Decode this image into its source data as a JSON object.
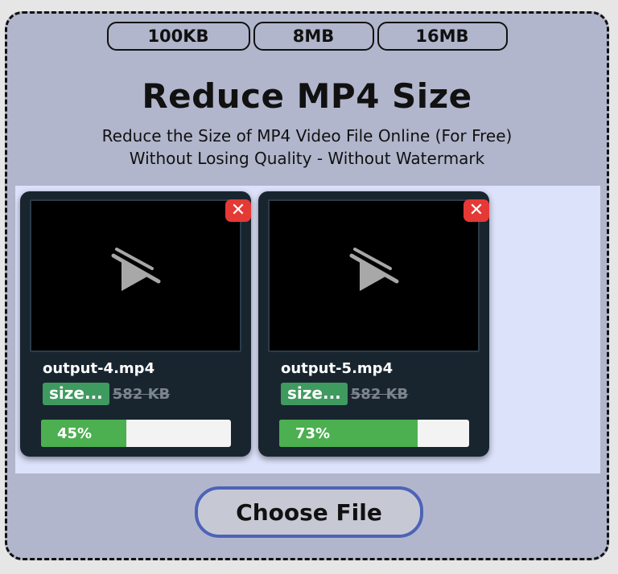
{
  "size_presets": [
    "100KB",
    "8MB",
    "16MB"
  ],
  "header": {
    "title": "Reduce MP4 Size",
    "subtitle_line1": "Reduce the Size of MP4 Video File Online (For Free)",
    "subtitle_line2": "Without Losing Quality - Without Watermark"
  },
  "files": [
    {
      "name": "output-4.mp4",
      "new_size": "size...",
      "original_size": "582 KB",
      "progress_label": "45%",
      "progress": 45
    },
    {
      "name": "output-5.mp4",
      "new_size": "size...",
      "original_size": "582 KB",
      "progress_label": "73%",
      "progress": 73
    }
  ],
  "icons": {
    "close": "✕",
    "video_placeholder": "video-off-icon"
  },
  "choose_button": "Choose File",
  "colors": {
    "progress_fill": "#4caf50",
    "close_button": "#e53935",
    "size_badge": "#3f9a5f",
    "choose_border": "#4d63b7"
  }
}
